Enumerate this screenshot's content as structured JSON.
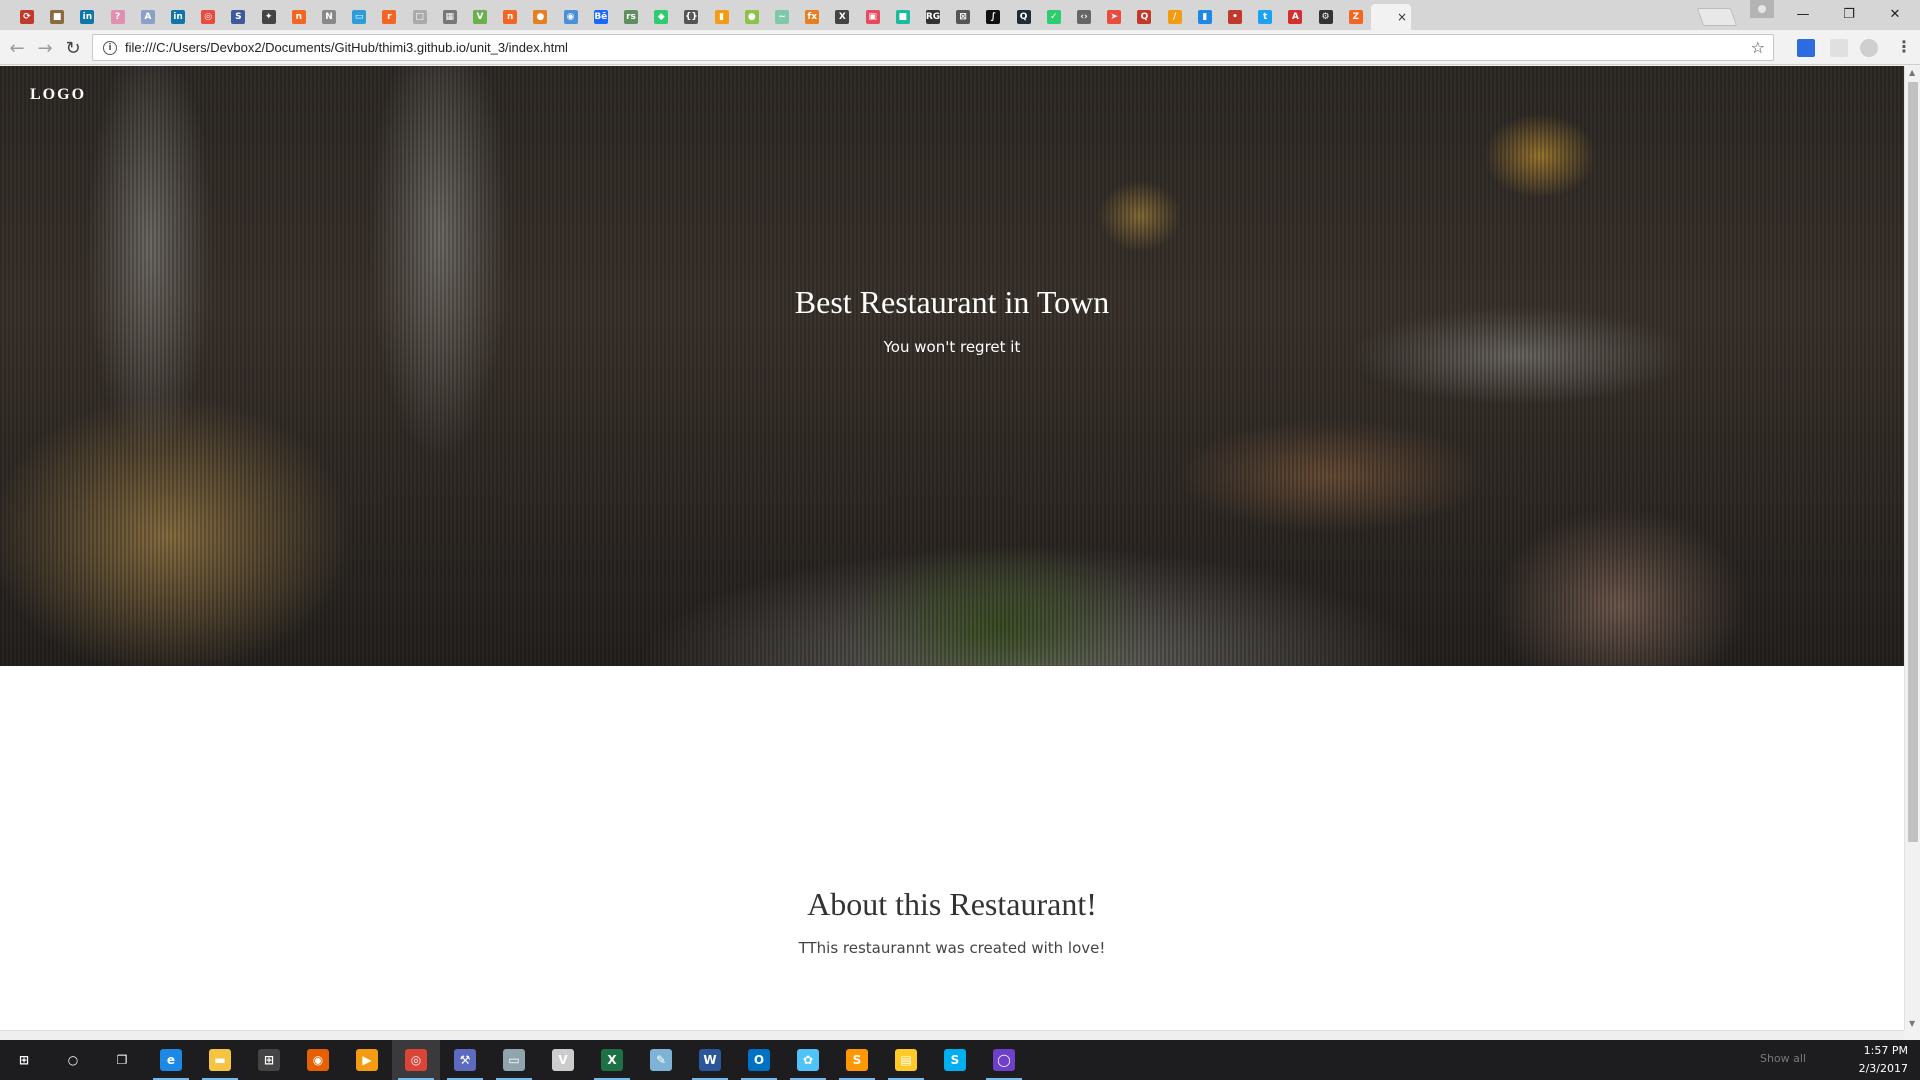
{
  "browser": {
    "url": "file:///C:/Users/Devbox2/Documents/GitHub/thimi3.github.io/unit_3/index.html",
    "tabs": [
      {
        "icon": "tab-favicon-1",
        "color": "#c0392b",
        "glyph": "⟳"
      },
      {
        "icon": "tab-favicon-2",
        "color": "#8b6b3f",
        "glyph": "■"
      },
      {
        "icon": "tab-favicon-linkedin",
        "color": "#0e76a8",
        "glyph": "in"
      },
      {
        "icon": "tab-favicon-4",
        "color": "#e08fb0",
        "glyph": "?"
      },
      {
        "icon": "tab-favicon-5",
        "color": "#8aa0c8",
        "glyph": "A"
      },
      {
        "icon": "tab-favicon-linkedin",
        "color": "#0e76a8",
        "glyph": "in"
      },
      {
        "icon": "tab-favicon-7",
        "color": "#e74c3c",
        "glyph": "◎"
      },
      {
        "icon": "tab-favicon-8",
        "color": "#3d5a9c",
        "glyph": "S"
      },
      {
        "icon": "tab-favicon-9",
        "color": "#444444",
        "glyph": "✦"
      },
      {
        "icon": "tab-favicon-10",
        "color": "#f26522",
        "glyph": "n"
      },
      {
        "icon": "tab-favicon-11",
        "color": "#888888",
        "glyph": "N"
      },
      {
        "icon": "tab-favicon-12",
        "color": "#2d9cdb",
        "glyph": "▭"
      },
      {
        "icon": "tab-favicon-13",
        "color": "#f26522",
        "glyph": "r"
      },
      {
        "icon": "tab-favicon-14",
        "color": "#aaaaaa",
        "glyph": "□"
      },
      {
        "icon": "tab-favicon-15",
        "color": "#777777",
        "glyph": "▦"
      },
      {
        "icon": "tab-favicon-16",
        "color": "#6ab04c",
        "glyph": "V"
      },
      {
        "icon": "tab-favicon-17",
        "color": "#f26522",
        "glyph": "n"
      },
      {
        "icon": "tab-favicon-18",
        "color": "#e67e22",
        "glyph": "●"
      },
      {
        "icon": "tab-favicon-19",
        "color": "#4a90d9",
        "glyph": "◉"
      },
      {
        "icon": "tab-favicon-20",
        "color": "#1769ff",
        "glyph": "Bē"
      },
      {
        "icon": "tab-favicon-21",
        "color": "#5f8f5f",
        "glyph": "rs"
      },
      {
        "icon": "tab-favicon-22",
        "color": "#2ecc71",
        "glyph": "◆"
      },
      {
        "icon": "tab-favicon-23",
        "color": "#555555",
        "glyph": "{}"
      },
      {
        "icon": "tab-favicon-24",
        "color": "#f39c12",
        "glyph": "▮"
      },
      {
        "icon": "tab-favicon-25",
        "color": "#8bc34a",
        "glyph": "●"
      },
      {
        "icon": "tab-favicon-26",
        "color": "#7fc8a9",
        "glyph": "~"
      },
      {
        "icon": "tab-favicon-27",
        "color": "#e67e22",
        "glyph": "fx"
      },
      {
        "icon": "tab-favicon-28",
        "color": "#444444",
        "glyph": "X"
      },
      {
        "icon": "tab-favicon-29",
        "color": "#e84a5f",
        "glyph": "▣"
      },
      {
        "icon": "tab-favicon-30",
        "color": "#1abc9c",
        "glyph": "■"
      },
      {
        "icon": "tab-favicon-31",
        "color": "#333333",
        "glyph": "RG"
      },
      {
        "icon": "tab-favicon-32",
        "color": "#555555",
        "glyph": "⊠"
      },
      {
        "icon": "tab-favicon-33",
        "color": "#111111",
        "glyph": "∫"
      },
      {
        "icon": "tab-favicon-34",
        "color": "#1d2b3a",
        "glyph": "Q"
      },
      {
        "icon": "tab-favicon-35",
        "color": "#2ecc71",
        "glyph": "✓"
      },
      {
        "icon": "tab-favicon-36",
        "color": "#666666",
        "glyph": "‹›"
      },
      {
        "icon": "tab-favicon-37",
        "color": "#e74c3c",
        "glyph": "➤"
      },
      {
        "icon": "tab-favicon-38",
        "color": "#c0392b",
        "glyph": "Q"
      },
      {
        "icon": "tab-favicon-39",
        "color": "#f39c12",
        "glyph": "∕"
      },
      {
        "icon": "tab-favicon-40",
        "color": "#1e88e5",
        "glyph": "▮"
      },
      {
        "icon": "tab-favicon-41",
        "color": "#c0392b",
        "glyph": "•"
      },
      {
        "icon": "tab-favicon-42",
        "color": "#1da1f2",
        "glyph": "t"
      },
      {
        "icon": "tab-favicon-43",
        "color": "#d32f2f",
        "glyph": "A"
      },
      {
        "icon": "tab-favicon-44",
        "color": "#333333",
        "glyph": "⚙"
      },
      {
        "icon": "tab-favicon-45",
        "color": "#f26522",
        "glyph": "Z"
      }
    ],
    "active_tab_close": "×",
    "window_controls": {
      "minimize": "—",
      "restore": "❐",
      "close": "✕"
    },
    "nav": {
      "back": "←",
      "forward": "→",
      "reload": "↻"
    },
    "bookmark_icon": "☆",
    "menu_icon": "⋮"
  },
  "page": {
    "logo": "LOGO",
    "hero_title": "Best Restaurant in Town",
    "hero_subtitle": "You won't regret it",
    "about_title": "About this Restaurant!",
    "about_text": "TThis restaurannt was created with love!"
  },
  "taskbar": {
    "items": [
      {
        "name": "start-button",
        "glyph": "⊞",
        "color": "#1d1d1f"
      },
      {
        "name": "cortana-button",
        "glyph": "○",
        "color": "#1d1d1f"
      },
      {
        "name": "task-view-button",
        "glyph": "❐",
        "color": "#1d1d1f"
      },
      {
        "name": "edge-app",
        "glyph": "e",
        "color": "#1e88e5"
      },
      {
        "name": "file-explorer-app",
        "glyph": "▬",
        "color": "#f5c542"
      },
      {
        "name": "store-app",
        "glyph": "⊞",
        "color": "#444444"
      },
      {
        "name": "firefox-app",
        "glyph": "◉",
        "color": "#e66000"
      },
      {
        "name": "media-app",
        "glyph": "▶",
        "color": "#f39c12"
      },
      {
        "name": "chrome-app",
        "glyph": "◎",
        "color": "#db4437"
      },
      {
        "name": "network-app",
        "glyph": "⚒",
        "color": "#5c6bc0"
      },
      {
        "name": "monitor-app",
        "glyph": "▭",
        "color": "#90a4ae"
      },
      {
        "name": "vivaldi-app",
        "glyph": "V",
        "color": "#cccccc"
      },
      {
        "name": "excel-app",
        "glyph": "X",
        "color": "#1e7145"
      },
      {
        "name": "notes-app",
        "glyph": "✎",
        "color": "#7fb3d5"
      },
      {
        "name": "word-app",
        "glyph": "W",
        "color": "#2b579a"
      },
      {
        "name": "outlook-app",
        "glyph": "O",
        "color": "#0072c6"
      },
      {
        "name": "paint-app",
        "glyph": "✿",
        "color": "#4fc3f7"
      },
      {
        "name": "sublime-app",
        "glyph": "S",
        "color": "#ff9800"
      },
      {
        "name": "files-app",
        "glyph": "▤",
        "color": "#ffca28"
      },
      {
        "name": "skype-app",
        "glyph": "S",
        "color": "#00aff0"
      },
      {
        "name": "github-app",
        "glyph": "◯",
        "color": "#6e40c9"
      }
    ],
    "show_all": "Show all",
    "time": "1:57 PM",
    "date": "2/3/2017"
  }
}
